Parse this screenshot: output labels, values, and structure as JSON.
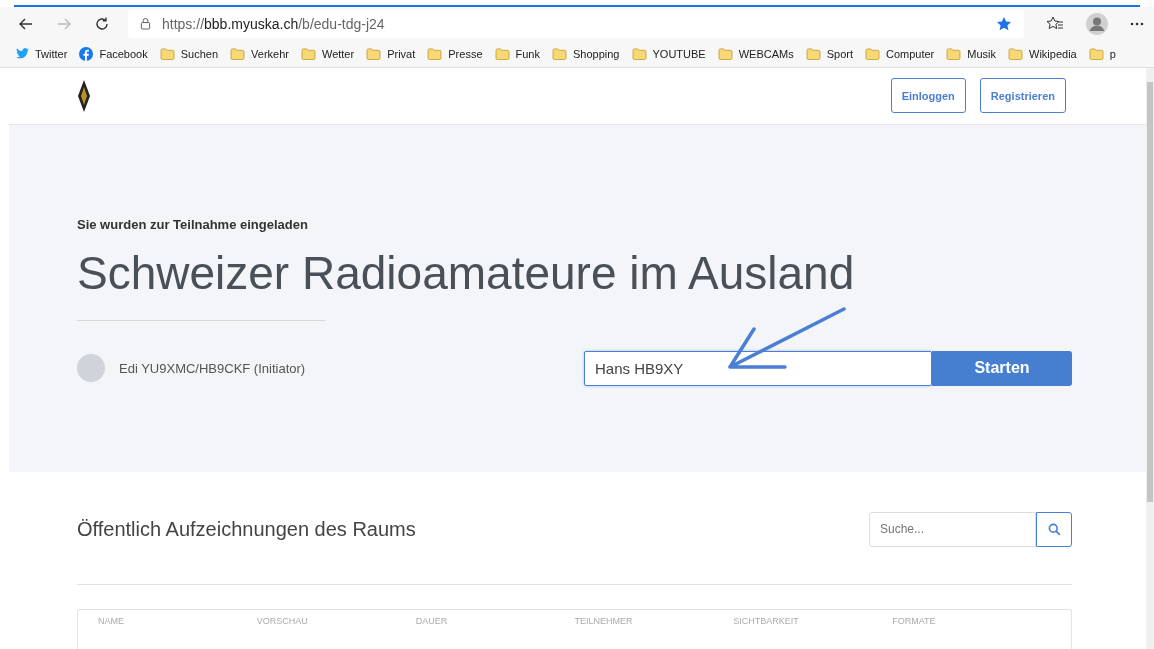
{
  "browser": {
    "url_prefix": "https://",
    "url_host": "bbb.myuska.ch",
    "url_path": "/b/edu-tdg-j24",
    "bookmarked": true,
    "bookmarks": [
      {
        "label": "Twitter",
        "kind": "twitter"
      },
      {
        "label": "Facebook",
        "kind": "facebook"
      },
      {
        "label": "Suchen",
        "kind": "folder"
      },
      {
        "label": "Verkehr",
        "kind": "folder"
      },
      {
        "label": "Wetter",
        "kind": "folder"
      },
      {
        "label": "Privat",
        "kind": "folder"
      },
      {
        "label": "Presse",
        "kind": "folder"
      },
      {
        "label": "Funk",
        "kind": "folder"
      },
      {
        "label": "Shopping",
        "kind": "folder"
      },
      {
        "label": "YOUTUBE",
        "kind": "folder"
      },
      {
        "label": "WEBCAMs",
        "kind": "folder"
      },
      {
        "label": "Sport",
        "kind": "folder"
      },
      {
        "label": "Computer",
        "kind": "folder"
      },
      {
        "label": "Musik",
        "kind": "folder"
      },
      {
        "label": "Wikipedia",
        "kind": "folder"
      },
      {
        "label": "p",
        "kind": "folder"
      }
    ]
  },
  "header": {
    "buttons": [
      "Einloggen",
      "Registrieren"
    ]
  },
  "hero": {
    "invited": "Sie wurden zur Teilnahme eingeladen",
    "title": "Schweizer Radioamateure im Ausland",
    "owner": "Edi YU9XMC/HB9CKF (Initiator)",
    "name_value": "Hans HB9XY",
    "start_button": "Starten"
  },
  "recordings": {
    "title": "Öffentlich Aufzeichnungen des Raums",
    "search_placeholder": "Suche...",
    "columns": [
      "NAME",
      "VORSCHAU",
      "DAUER",
      "TEILNEHMER",
      "SICHTBARKEIT",
      "FORMATE"
    ]
  }
}
